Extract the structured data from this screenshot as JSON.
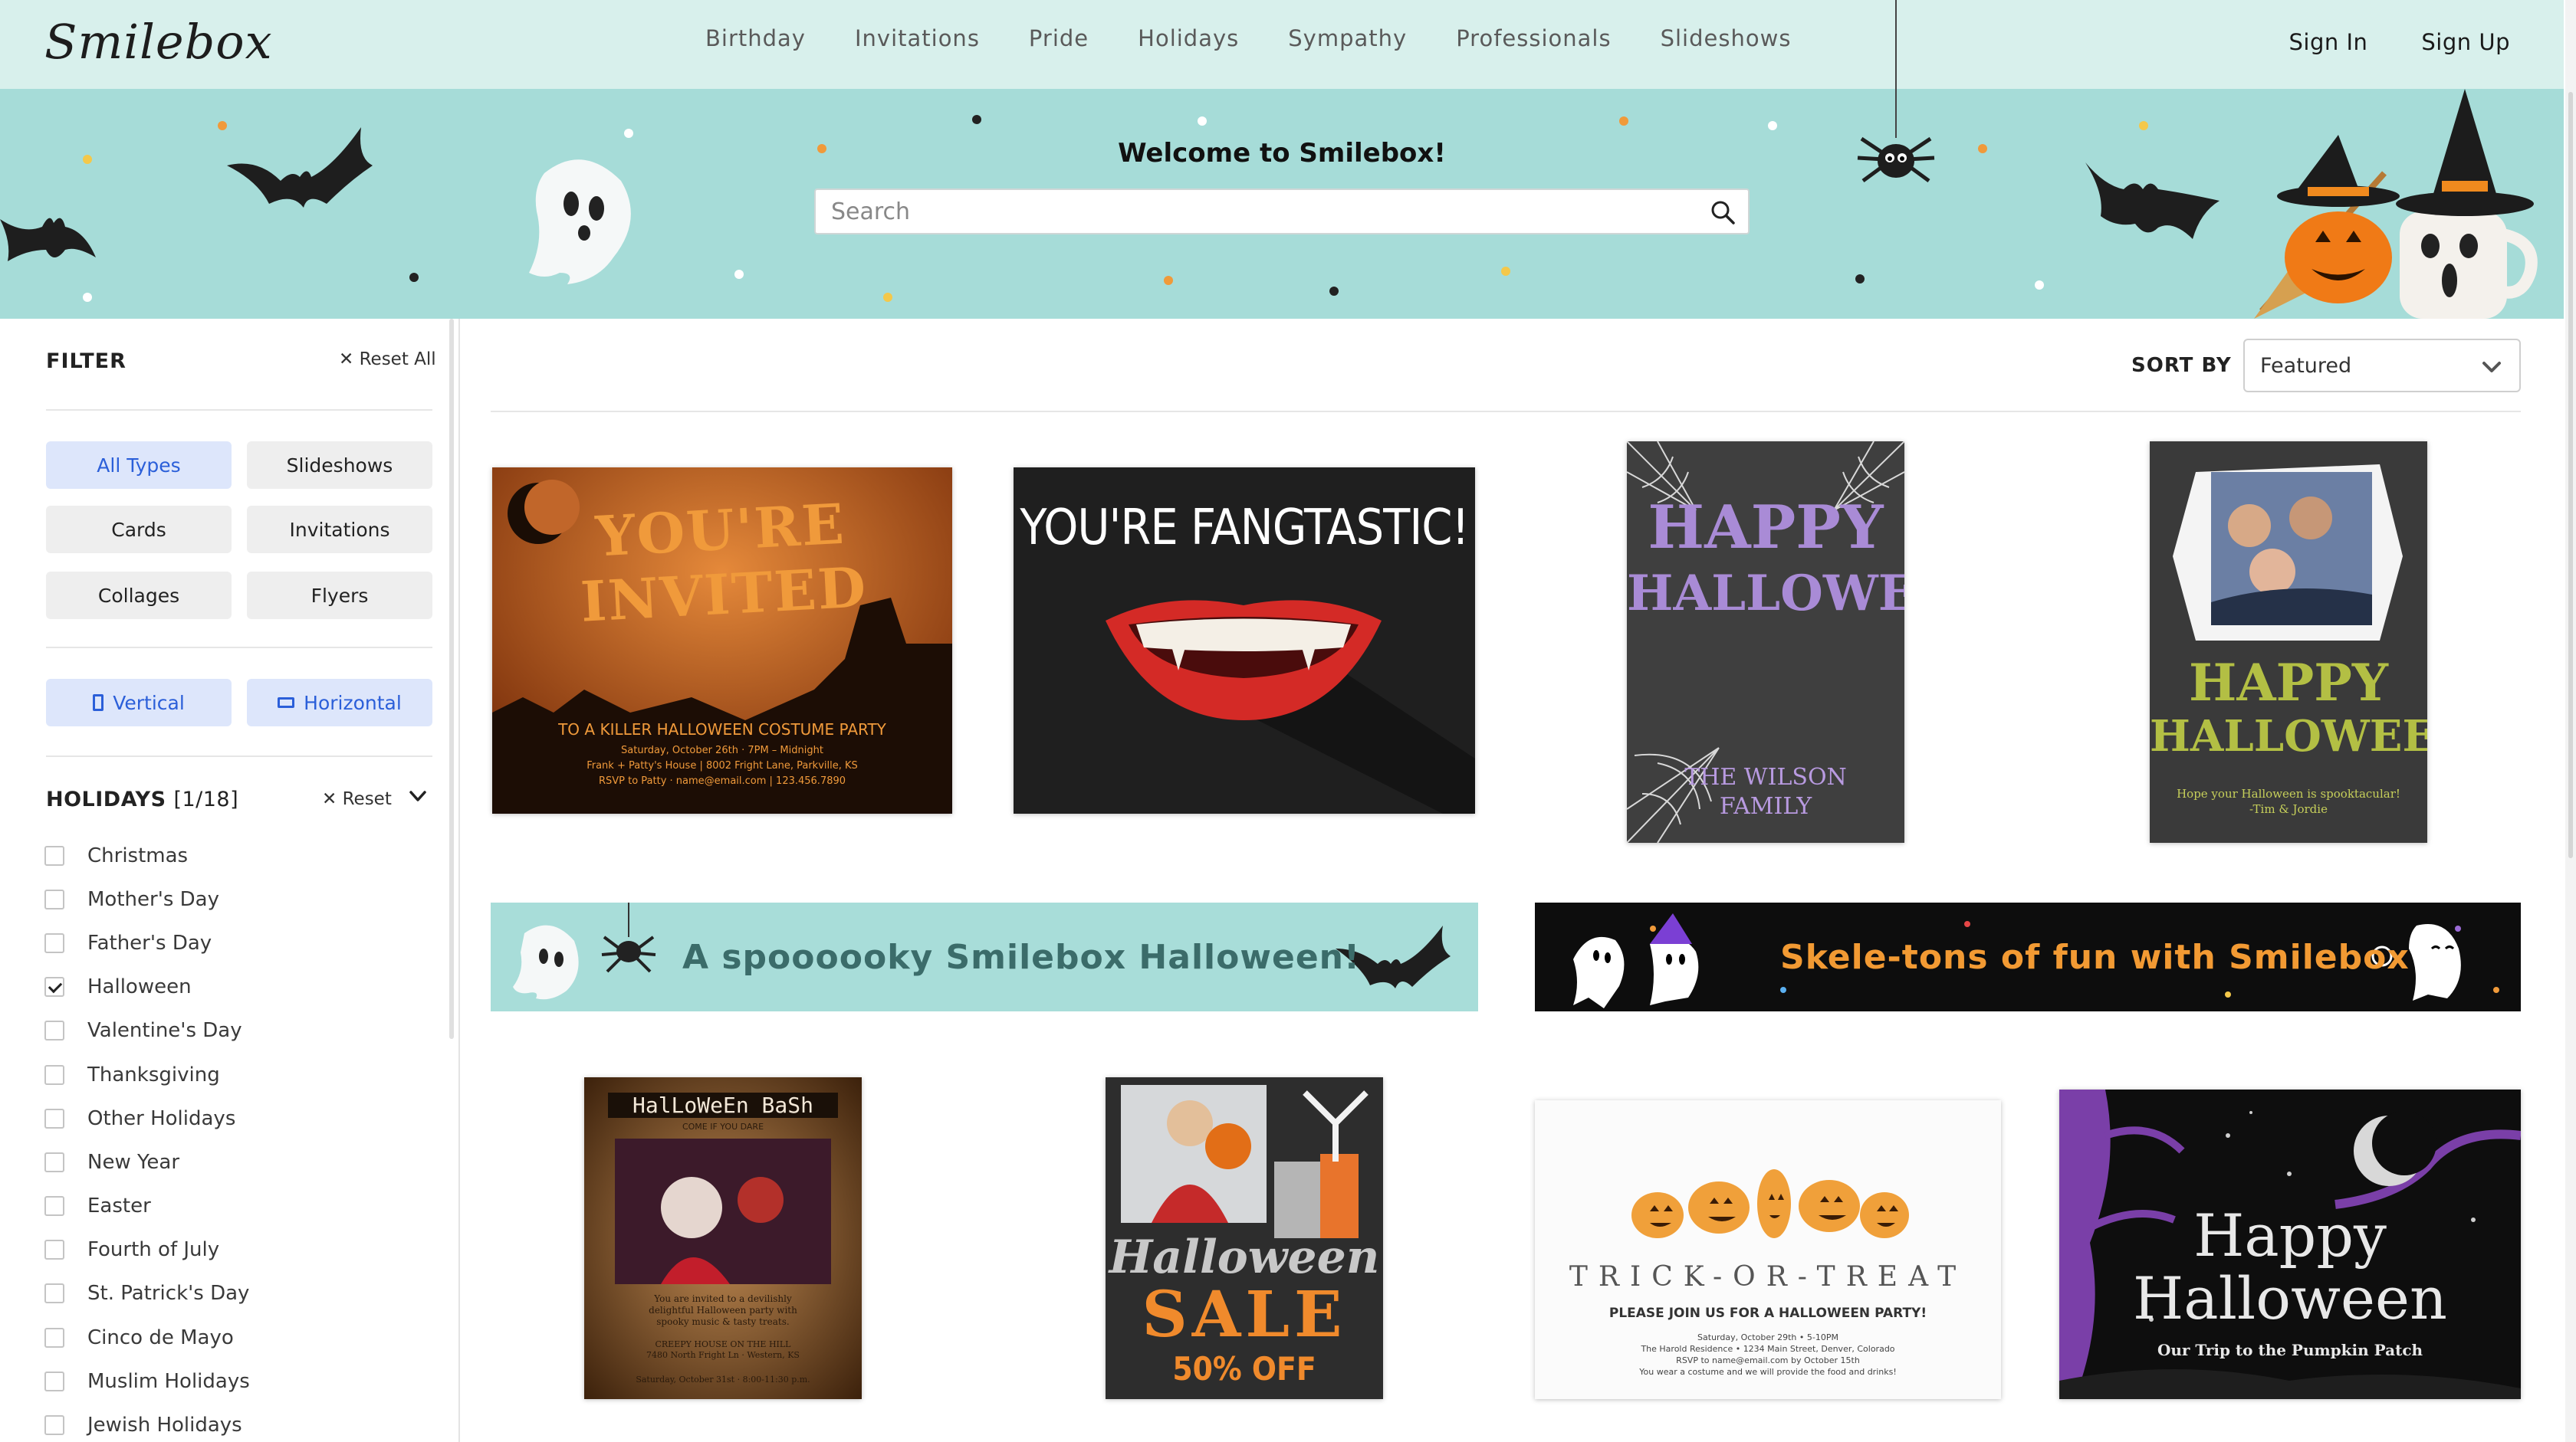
{
  "brand": {
    "logo": "Smilebox"
  },
  "nav": {
    "links": [
      "Birthday",
      "Invitations",
      "Pride",
      "Holidays",
      "Sympathy",
      "Professionals",
      "Slideshows"
    ],
    "sign_in": "Sign In",
    "sign_up": "Sign Up"
  },
  "hero": {
    "title": "Welcome to Smilebox!",
    "search_placeholder": "Search",
    "search_value": ""
  },
  "filter": {
    "title": "FILTER",
    "reset_all": "Reset All",
    "types": [
      "All Types",
      "Slideshows",
      "Cards",
      "Invitations",
      "Collages",
      "Flyers"
    ],
    "active_type": "All Types",
    "orientation": {
      "vertical": "Vertical",
      "horizontal": "Horizontal"
    },
    "holidays": {
      "title": "HOLIDAYS",
      "count": "[1/18]",
      "reset": "Reset",
      "items": [
        {
          "label": "Christmas",
          "checked": false
        },
        {
          "label": "Mother's Day",
          "checked": false
        },
        {
          "label": "Father's Day",
          "checked": false
        },
        {
          "label": "Halloween",
          "checked": true
        },
        {
          "label": "Valentine's Day",
          "checked": false
        },
        {
          "label": "Thanksgiving",
          "checked": false
        },
        {
          "label": "Other Holidays",
          "checked": false
        },
        {
          "label": "New Year",
          "checked": false
        },
        {
          "label": "Easter",
          "checked": false
        },
        {
          "label": "Fourth of July",
          "checked": false
        },
        {
          "label": "St. Patrick's Day",
          "checked": false
        },
        {
          "label": "Cinco de Mayo",
          "checked": false
        },
        {
          "label": "Muslim Holidays",
          "checked": false
        },
        {
          "label": "Jewish Holidays",
          "checked": false
        }
      ]
    }
  },
  "sort": {
    "label": "SORT BY",
    "value": "Featured"
  },
  "cards": {
    "invited": {
      "title": "YOU'RE INVITED",
      "subtitle": "TO A KILLER HALLOWEEN COSTUME PARTY",
      "line1": "Saturday, October 26th · 7PM – Midnight",
      "line2": "Frank + Patty's House | 8002 Fright Lane, Parkville, KS",
      "line3": "RSVP to Patty · name@email.com | 123.456.7890"
    },
    "fangtastic": {
      "title": "YOU'RE FANGTASTIC!"
    },
    "wilson": {
      "title1": "HAPPY",
      "title2": "HALLOWEEN",
      "family1": "THE WILSON",
      "family2": "FAMILY"
    },
    "photo_hh": {
      "title1": "HAPPY",
      "title2": "HALLOWEEN",
      "msg1": "Hope your Halloween is spooktacular!",
      "msg2": "-Tim & Jordie"
    },
    "bash": {
      "title": "HalLoWeEn BaSh",
      "tag": "COME IF YOU DARE",
      "body1": "You are invited to a devilishly",
      "body2": "delightful Halloween party with",
      "body3": "spooky music & tasty treats.",
      "addr1": "CREEPY HOUSE ON THE HILL",
      "addr2": "7480 North Fright Ln · Western, KS",
      "date": "Saturday, October 31st · 8:00-11:30 p.m."
    },
    "sale": {
      "title1": "Halloween",
      "title2": "SALE",
      "offer": "50% OFF"
    },
    "trick": {
      "title": "TRICK-OR-TREAT",
      "subtitle": "PLEASE JOIN US FOR A HALLOWEEN PARTY!",
      "line1": "Saturday, October 29th • 5-10PM",
      "line2": "The Harold Residence • 1234 Main Street, Denver, Colorado",
      "line3": "RSVP to name@email.com by October 15th",
      "line4": "You wear a costume and we will provide the food and drinks!"
    },
    "pumpkin": {
      "title1": "Happy",
      "title2": "Halloween",
      "subtitle": "Our Trip to the Pumpkin Patch"
    }
  },
  "banners": {
    "spooky": "A spoooooky Smilebox Halloween!",
    "skele": "Skele-tons of fun with Smilebox"
  },
  "colors": {
    "nav_bg": "#d8f0ec",
    "hero_bg": "#a6dcd8",
    "accent_blue": "#2b5fd9",
    "chip_active": "#dde6fb",
    "skele_text": "#f29a33",
    "spooky_text": "#3b6c6a"
  }
}
